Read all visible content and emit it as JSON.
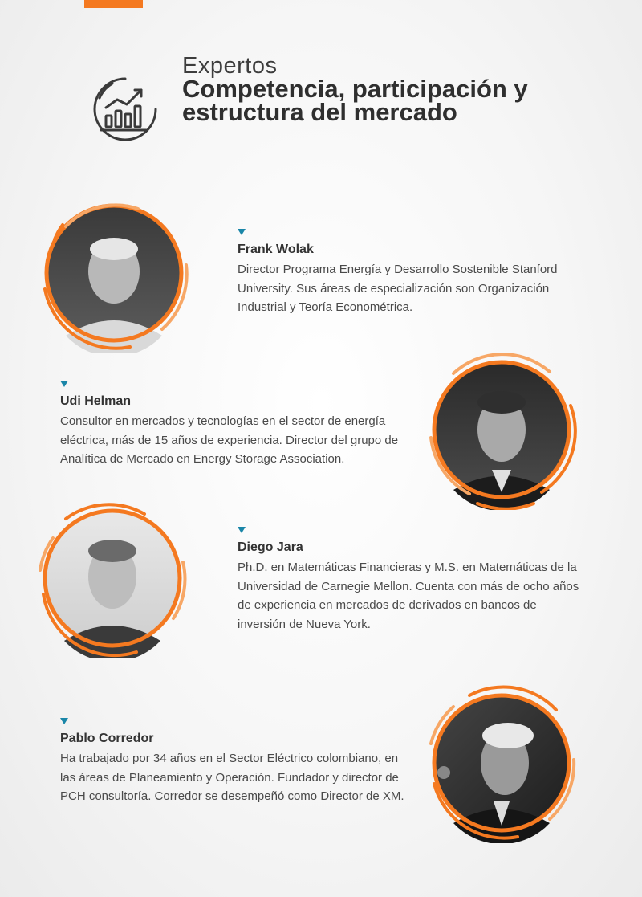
{
  "header": {
    "kicker": "Expertos",
    "title": "Competencia, participación y estructura del mercado",
    "icon": "bar-chart-growth-icon"
  },
  "colors": {
    "accent": "#f47920",
    "accent_light": "#f7a766",
    "marker": "#1a86a8"
  },
  "experts": [
    {
      "name": "Frank Wolak",
      "bio": "Director Programa Energía y Desarrollo Sostenible Stanford University. Sus áreas de especialización son Organización Industrial y Teoría Econométrica."
    },
    {
      "name": "Udi Helman",
      "bio": "Consultor en mercados y tecnologías en el sector de energía eléctrica, más de 15 años de experiencia. Director del grupo de Analítica de Mercado en Energy Storage Association."
    },
    {
      "name": "Diego Jara",
      "bio": "Ph.D. en Matemáticas Financieras y M.S. en Matemáticas de la Universidad de Carnegie Mellon. Cuenta con más de ocho años de experiencia en mercados de derivados en bancos de inversión de Nueva York."
    },
    {
      "name": "Pablo Corredor",
      "bio": "Ha trabajado por 34 años en el Sector Eléctrico colombiano, en las áreas de Planeamiento y Operación. Fundador y director de PCH consultoría. Corredor se desempeñó como Director de XM."
    }
  ]
}
